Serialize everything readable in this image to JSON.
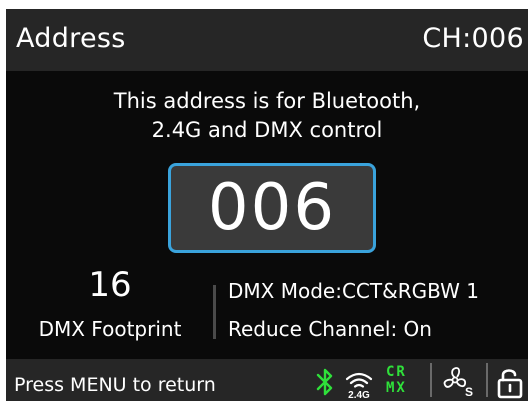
{
  "header": {
    "title": "Address",
    "channel": "CH:006"
  },
  "info": {
    "line1": "This address is for Bluetooth,",
    "line2": "2.4G and DMX control"
  },
  "address": {
    "value": "006"
  },
  "footprint": {
    "value": "16",
    "label": "DMX Footprint"
  },
  "mode": {
    "dmx_mode": "DMX Mode:CCT&RGBW 1",
    "reduce_channel": "Reduce Channel: On"
  },
  "footer": {
    "hint": "Press MENU to return",
    "wifi_label": "2.4G",
    "crmx_top": "CR",
    "crmx_bottom": "MX",
    "fan_label": "S",
    "icons": [
      "bluetooth-icon",
      "wireless-2.4g-icon",
      "crmx-icon",
      "fan-silent-icon",
      "unlock-icon"
    ]
  },
  "colors": {
    "accent_border": "#3aa3dc",
    "status_green": "#2fe03a",
    "header_bg": "#262626",
    "screen_bg": "#0a0a0a",
    "address_box_bg": "#3a3a3a"
  }
}
